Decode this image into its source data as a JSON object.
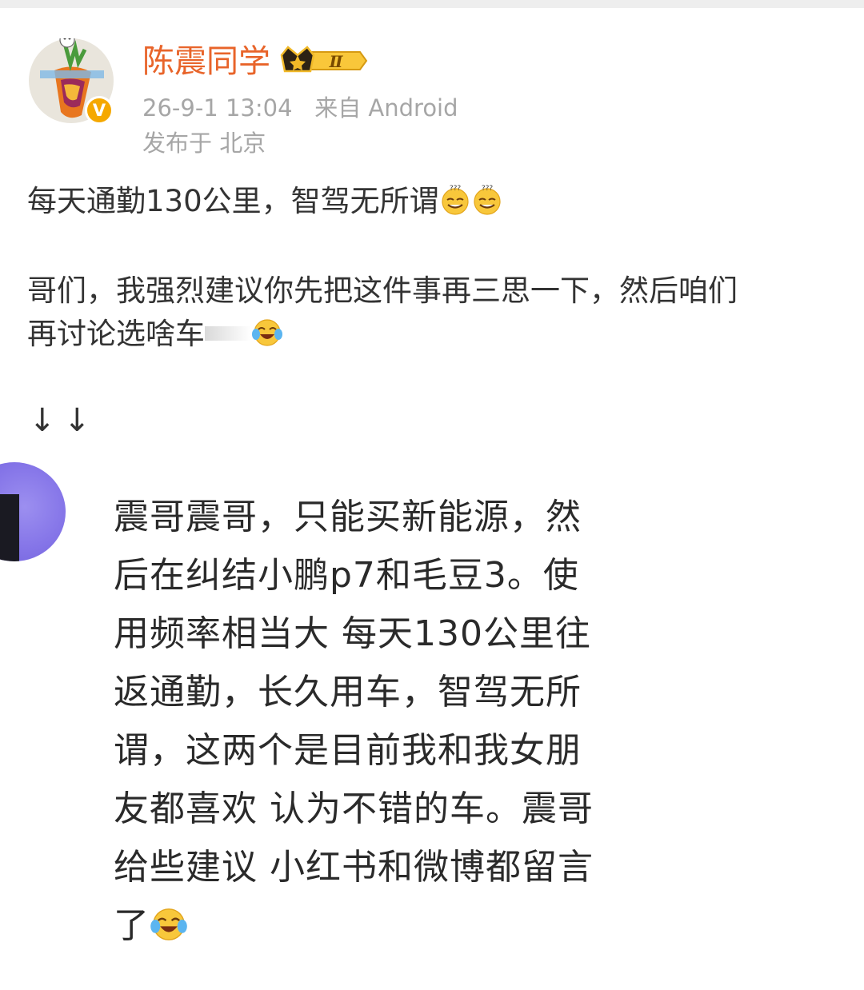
{
  "post": {
    "username": "陈震同学",
    "level_badge": "Ⅱ",
    "verified_badge": "V",
    "timestamp": "26-9-1 13:04",
    "source": "来自 Android",
    "location": "发布于 北京",
    "line1": "每天通勤130公里，智驾无所谓",
    "para2_line1": "哥们，我强烈建议你先把这件事再三思一下，然后咱们",
    "para2_line2": "再讨论选啥车",
    "arrows": "↓↓"
  },
  "quote": {
    "lines": [
      "震哥震哥，只能买新能源，然",
      "后在纠结小鹏p7和毛豆3。使",
      "用频率相当大 每天130公里往",
      "返通勤，长久用车，智驾无所",
      "谓，这两个是目前我和我女朋",
      "友都喜欢 认为不错的车。震哥",
      "给些建议 小红书和微博都留言",
      "了"
    ]
  },
  "colors": {
    "username": "#e8642a",
    "meta": "#a6a6a6",
    "text": "#333333",
    "verified": "#f5a800"
  },
  "icons": [
    "verified-v-icon",
    "crown-level-icon",
    "sweat-smile-emoji-icon",
    "laugh-cry-emoji-icon"
  ]
}
